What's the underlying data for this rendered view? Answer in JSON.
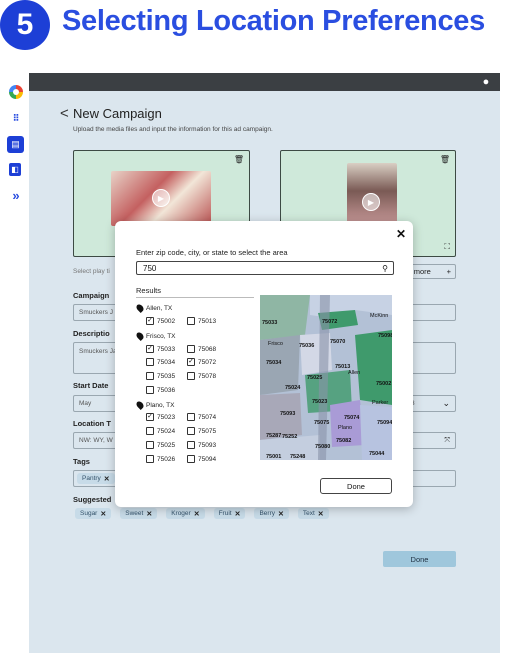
{
  "header": {
    "step": "5",
    "title": "Selecting Location Preferences"
  },
  "campaign": {
    "back_glyph": "<",
    "title": "New Campaign",
    "subtitle": "Upload the media files and input the information for this ad campaign.",
    "select_play_hint": "Select play ti",
    "add_more_label": "l more",
    "campaign_label": "Campaign",
    "campaign_value": "Smuckers J",
    "description_label": "Descriptio",
    "description_value": "Smuckers Ja",
    "start_date_label": "Start Date",
    "start_date_value": "May",
    "end_date_partial": "3",
    "location_label": "Location T",
    "location_value": "NW: WY, W",
    "tags_label": "Tags",
    "tags": [
      "Pantry"
    ],
    "suggested_label": "Suggested",
    "suggested_tags": [
      "Sugar",
      "Sweet",
      "Kroger",
      "Fruit",
      "Berry",
      "Text"
    ],
    "done_label": "Done"
  },
  "modal": {
    "prompt": "Enter zip code, city, or state to select the area",
    "search_value": "750",
    "results_label": "Results",
    "done_label": "Done",
    "groups": [
      {
        "city": "Allen, TX",
        "zips": [
          {
            "code": "75002",
            "checked": true
          },
          {
            "code": "75013",
            "checked": false
          }
        ]
      },
      {
        "city": "Frisco, TX",
        "zips": [
          {
            "code": "75033",
            "checked": true
          },
          {
            "code": "75068",
            "checked": false
          },
          {
            "code": "75034",
            "checked": false
          },
          {
            "code": "75072",
            "checked": true
          },
          {
            "code": "75035",
            "checked": false
          },
          {
            "code": "75078",
            "checked": false
          },
          {
            "code": "75036",
            "checked": false
          }
        ]
      },
      {
        "city": "Plano, TX",
        "zips": [
          {
            "code": "75023",
            "checked": true
          },
          {
            "code": "75074",
            "checked": false
          },
          {
            "code": "75024",
            "checked": false
          },
          {
            "code": "75075",
            "checked": false
          },
          {
            "code": "75025",
            "checked": false
          },
          {
            "code": "75093",
            "checked": false
          },
          {
            "code": "75026",
            "checked": false
          },
          {
            "code": "75094",
            "checked": false
          }
        ]
      }
    ],
    "map_labels": [
      "75033",
      "75072",
      "McKinn",
      "75036",
      "75070",
      "75034",
      "75013",
      "Allen",
      "75024",
      "75025",
      "75002",
      "75093",
      "75023",
      "Parker",
      "75075",
      "75074",
      "75287",
      "75252",
      "Plano",
      "75094",
      "75082",
      "75080",
      "75001",
      "75248",
      "75044",
      "75098",
      "Frisco"
    ]
  },
  "icons": {
    "check": "✓",
    "remove": "✕",
    "close": "✕"
  },
  "colors": {
    "accent": "#2a4ee0",
    "map_green": "#3f9a6c"
  }
}
